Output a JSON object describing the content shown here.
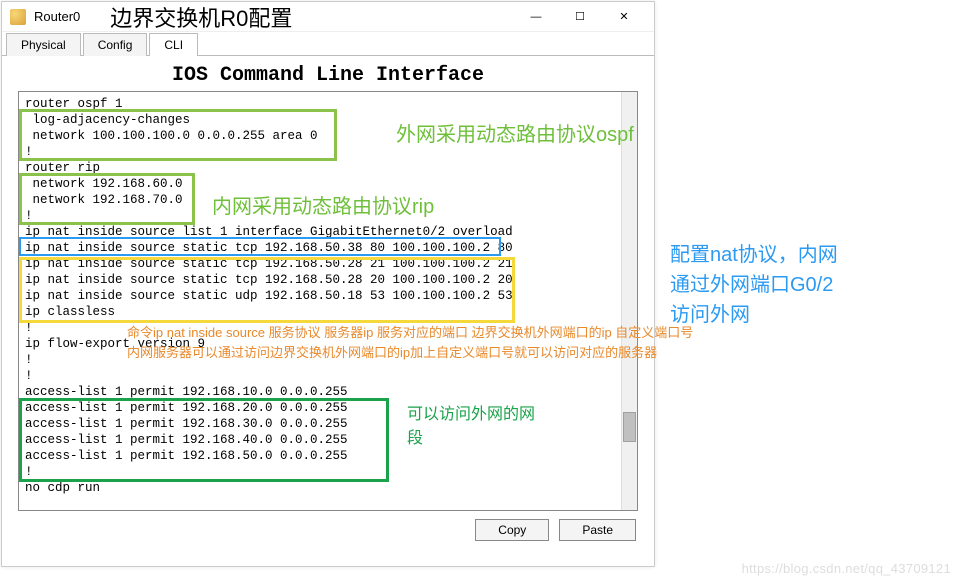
{
  "window": {
    "title": "Router0",
    "ext_title": "边界交换机R0配置",
    "min": "—",
    "max": "☐",
    "close": "✕"
  },
  "tabs": {
    "physical": "Physical",
    "config": "Config",
    "cli": "CLI"
  },
  "cli_heading": "IOS Command Line Interface",
  "cli": "router ospf 1\n log-adjacency-changes\n network 100.100.100.0 0.0.0.255 area 0\n!\nrouter rip\n network 192.168.60.0\n network 192.168.70.0\n!\nip nat inside source list 1 interface GigabitEthernet0/2 overload\nip nat inside source static tcp 192.168.50.38 80 100.100.100.2 80 \nip nat inside source static tcp 192.168.50.28 21 100.100.100.2 21 \nip nat inside source static tcp 192.168.50.28 20 100.100.100.2 20 \nip nat inside source static udp 192.168.50.18 53 100.100.100.2 53 \nip classless\n!\nip flow-export version 9\n!\n!\naccess-list 1 permit 192.168.10.0 0.0.0.255\naccess-list 1 permit 192.168.20.0 0.0.0.255\naccess-list 1 permit 192.168.30.0 0.0.0.255\naccess-list 1 permit 192.168.40.0 0.0.0.255\naccess-list 1 permit 192.168.50.0 0.0.0.255\n!\nno cdp run",
  "buttons": {
    "copy": "Copy",
    "paste": "Paste"
  },
  "anno": {
    "ospf": "外网采用动态路由协议ospf",
    "rip": "内网采用动态路由协议rip",
    "nat1": "配置nat协议，内网",
    "nat2": "通过外网端口G0/2",
    "nat3": "访问外网",
    "hint1": "命令ip nat inside source 服务协议 服务器ip 服务对应的端口 边界交换机外网端口的ip 自定义端口号",
    "hint2": "内网服务器可以通过访问边界交换机外网端口的ip加上自定义端口号就可以访问对应的服务器",
    "acl1": "可以访问外网的网",
    "acl2": "段"
  },
  "colors": {
    "green_light": "#8bc34a",
    "green_dark": "#1aa34a",
    "blue": "#2b9af3",
    "yellow": "#f5d93b",
    "orange": "#e8892b"
  },
  "watermark": "https://blog.csdn.net/qq_43709121"
}
